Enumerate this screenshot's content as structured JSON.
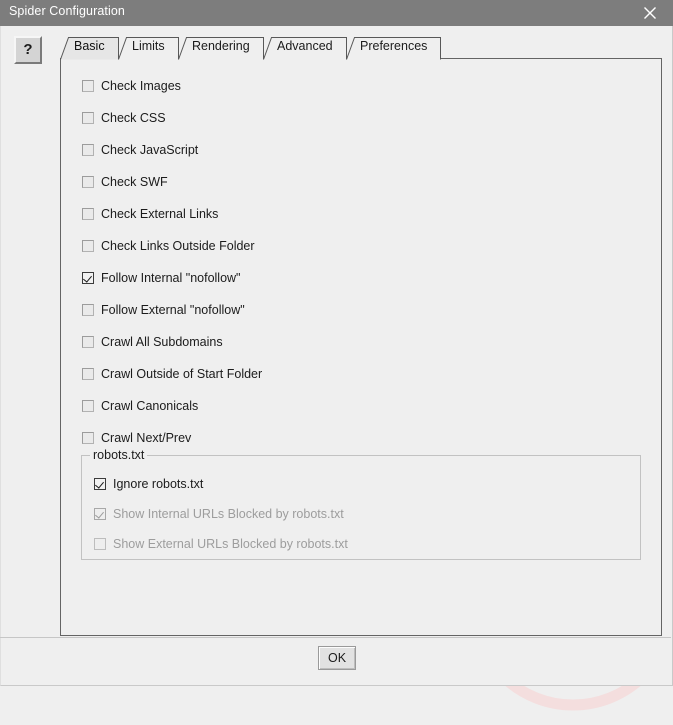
{
  "window": {
    "title": "Spider Configuration",
    "close_icon": "close-icon",
    "titlebar_color": "#7d7d7d",
    "body_color": "#efefef"
  },
  "help_button": {
    "label": "?",
    "icon": "question-mark-icon"
  },
  "tabs": [
    {
      "label": "Basic",
      "selected": true
    },
    {
      "label": "Limits",
      "selected": false
    },
    {
      "label": "Rendering",
      "selected": false
    },
    {
      "label": "Advanced",
      "selected": false
    },
    {
      "label": "Preferences",
      "selected": false
    }
  ],
  "basic_panel": {
    "checkboxes": [
      {
        "label": "Check Images",
        "checked": false,
        "disabled": false
      },
      {
        "label": "Check CSS",
        "checked": false,
        "disabled": false
      },
      {
        "label": "Check JavaScript",
        "checked": false,
        "disabled": false
      },
      {
        "label": "Check SWF",
        "checked": false,
        "disabled": false
      },
      {
        "label": "Check External Links",
        "checked": false,
        "disabled": false
      },
      {
        "label": "Check Links Outside Folder",
        "checked": false,
        "disabled": false
      },
      {
        "label": "Follow Internal \"nofollow\"",
        "checked": true,
        "disabled": false
      },
      {
        "label": "Follow External \"nofollow\"",
        "checked": false,
        "disabled": false
      },
      {
        "label": "Crawl All Subdomains",
        "checked": false,
        "disabled": false
      },
      {
        "label": "Crawl Outside of Start Folder",
        "checked": false,
        "disabled": false
      },
      {
        "label": "Crawl Canonicals",
        "checked": false,
        "disabled": false
      },
      {
        "label": "Crawl Next/Prev",
        "checked": false,
        "disabled": false
      }
    ],
    "robots_group": {
      "title": "robots.txt",
      "checkboxes": [
        {
          "label": "Ignore robots.txt",
          "checked": true,
          "disabled": false
        },
        {
          "label": "Show Internal URLs Blocked by robots.txt",
          "checked": true,
          "disabled": true
        },
        {
          "label": "Show External URLs Blocked by robots.txt",
          "checked": false,
          "disabled": true
        }
      ]
    }
  },
  "footer": {
    "ok_label": "OK"
  },
  "watermark": {
    "name": "target-arrow-logo-watermark",
    "color": "#f2dada"
  }
}
